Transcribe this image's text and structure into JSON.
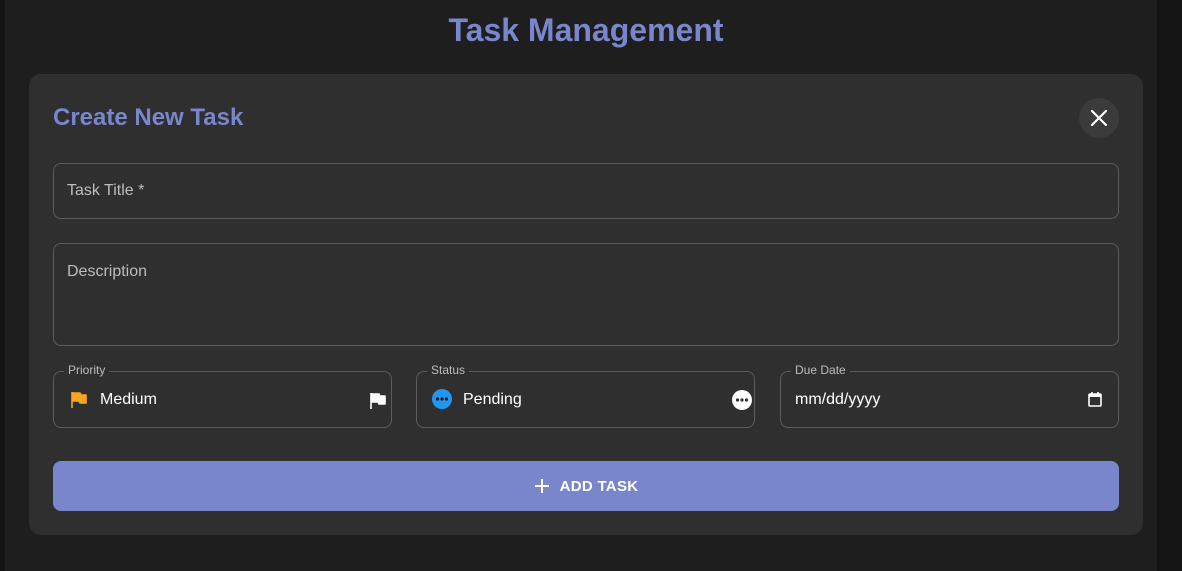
{
  "page": {
    "title": "Task Management"
  },
  "dialog": {
    "title": "Create New Task",
    "close_icon": "close-icon"
  },
  "form": {
    "task_title": {
      "placeholder": "Task Title *",
      "value": ""
    },
    "description": {
      "placeholder": "Description",
      "value": ""
    },
    "priority": {
      "label": "Priority",
      "value": "Medium",
      "icon": "flag-icon",
      "icon_color": "#f5a623"
    },
    "status": {
      "label": "Status",
      "value": "Pending",
      "icon": "more-horizontal-circle-icon",
      "icon_color": "#2196f3"
    },
    "due_date": {
      "label": "Due Date",
      "value": "mm/dd/yyyy",
      "icon": "calendar-icon"
    },
    "submit": {
      "label": "ADD TASK",
      "icon": "plus-icon"
    }
  },
  "colors": {
    "accent": "#7986cb",
    "card_bg": "#2f2f2f",
    "page_bg": "#1e1e1e"
  }
}
